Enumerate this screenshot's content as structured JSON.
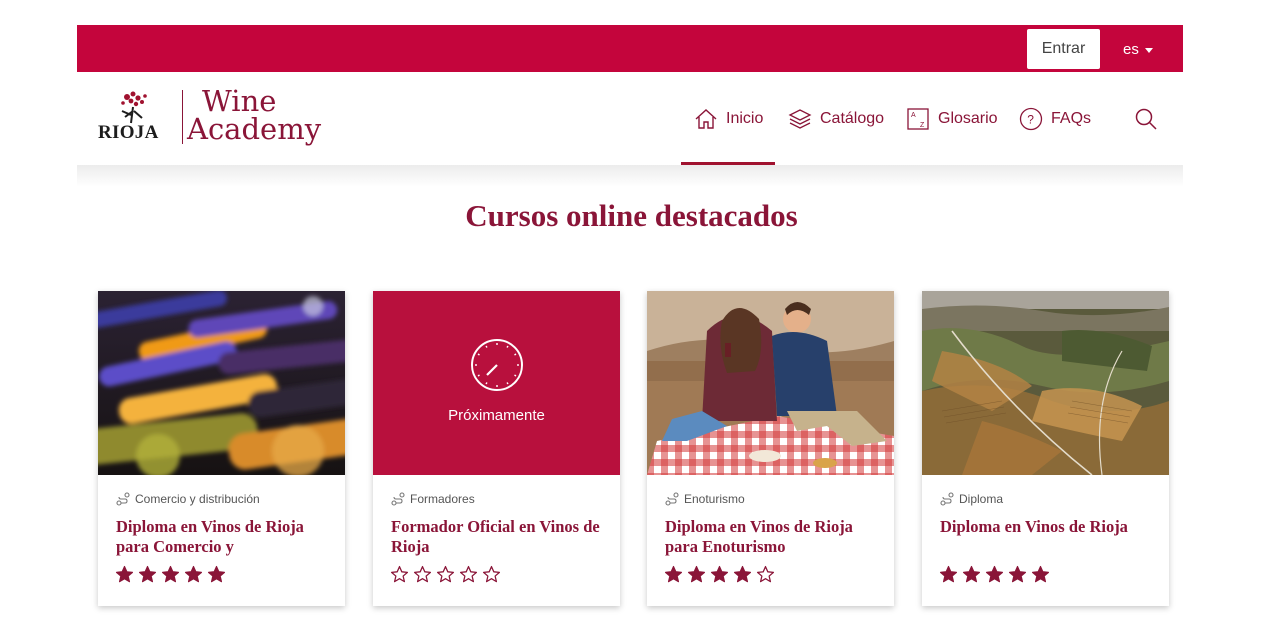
{
  "topbar": {
    "login_label": "Entrar",
    "language": "es"
  },
  "logo": {
    "brand": "RIOJA",
    "line1": "Wine",
    "line2": "Academy"
  },
  "nav": {
    "items": [
      {
        "label": "Inicio",
        "icon": "home-icon",
        "active": true
      },
      {
        "label": "Catálogo",
        "icon": "layers-icon",
        "active": false
      },
      {
        "label": "Glosario",
        "icon": "glossary-icon",
        "active": false
      },
      {
        "label": "FAQs",
        "icon": "question-icon",
        "active": false
      }
    ],
    "search_icon": "search-icon"
  },
  "main": {
    "title": "Cursos online destacados"
  },
  "courses": [
    {
      "category": "Comercio y distribución",
      "title": "Diploma en Vinos de Rioja para Comercio y",
      "rating": 5,
      "image": "wine-bottles"
    },
    {
      "category": "Formadores",
      "title": "Formador Oficial en Vinos de Rioja",
      "rating": 0,
      "image": "coming-soon",
      "overlay": "Próximamente"
    },
    {
      "category": "Enoturismo",
      "title": "Diploma en Vinos de Rioja para Enoturismo",
      "rating": 4,
      "image": "picnic-couple"
    },
    {
      "category": "Diploma",
      "title": "Diploma en Vinos de Rioja",
      "rating": 5,
      "image": "vineyard-aerial"
    }
  ],
  "colors": {
    "brand": "#c4053c",
    "text_accent": "#8a1538",
    "star": "#8a1538"
  }
}
